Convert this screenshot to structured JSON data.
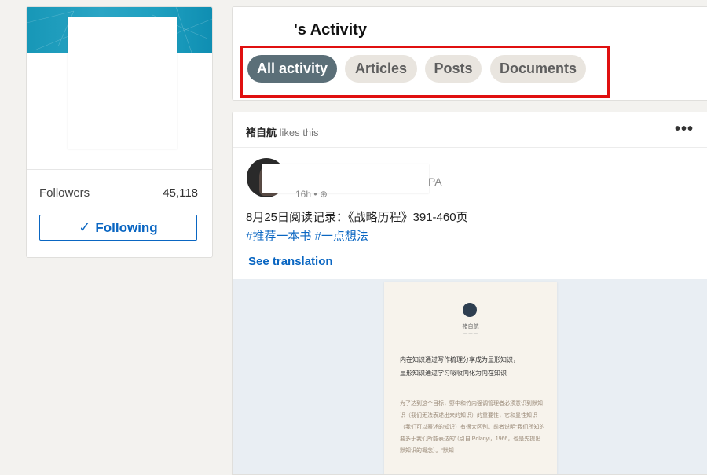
{
  "profile": {
    "followers_label": "Followers",
    "followers_count": "45,118",
    "following_button": "Following",
    "banner_color": "#1fa0c0"
  },
  "activity": {
    "title_suffix": "'s Activity",
    "filters": [
      {
        "label": "All activity",
        "active": true
      },
      {
        "label": "Articles",
        "active": false
      },
      {
        "label": "Posts",
        "active": false
      },
      {
        "label": "Documents",
        "active": false
      }
    ],
    "highlight_color": "#e01010"
  },
  "feed": {
    "liker": "褚自航",
    "likes_text": " likes this",
    "author_suffix": "PA",
    "post_time": "16h • ",
    "post_text": "8月25日阅读记录：《战略历程》391-460页",
    "post_tags": "#推荐一本书 #一点想法",
    "see_translation": "See translation",
    "document": {
      "author": "褚自航",
      "heading_line_1": "内在知识通过写作梳理分享成为显形知识，",
      "heading_line_2": "显形知识通过学习吸收内化为内在知识",
      "body": "为了达到这个目标，野中和竹内强调管理者必须意识到默知识（我们无法表述出来的知识）的重要性，它和显性知识（我们可以表述的知识）有很大区别。前者说明“我们所知的要多于我们所能表达的”（引自 Polanyi，1966，也是先提出默知识的概念）。“默知"
    }
  }
}
